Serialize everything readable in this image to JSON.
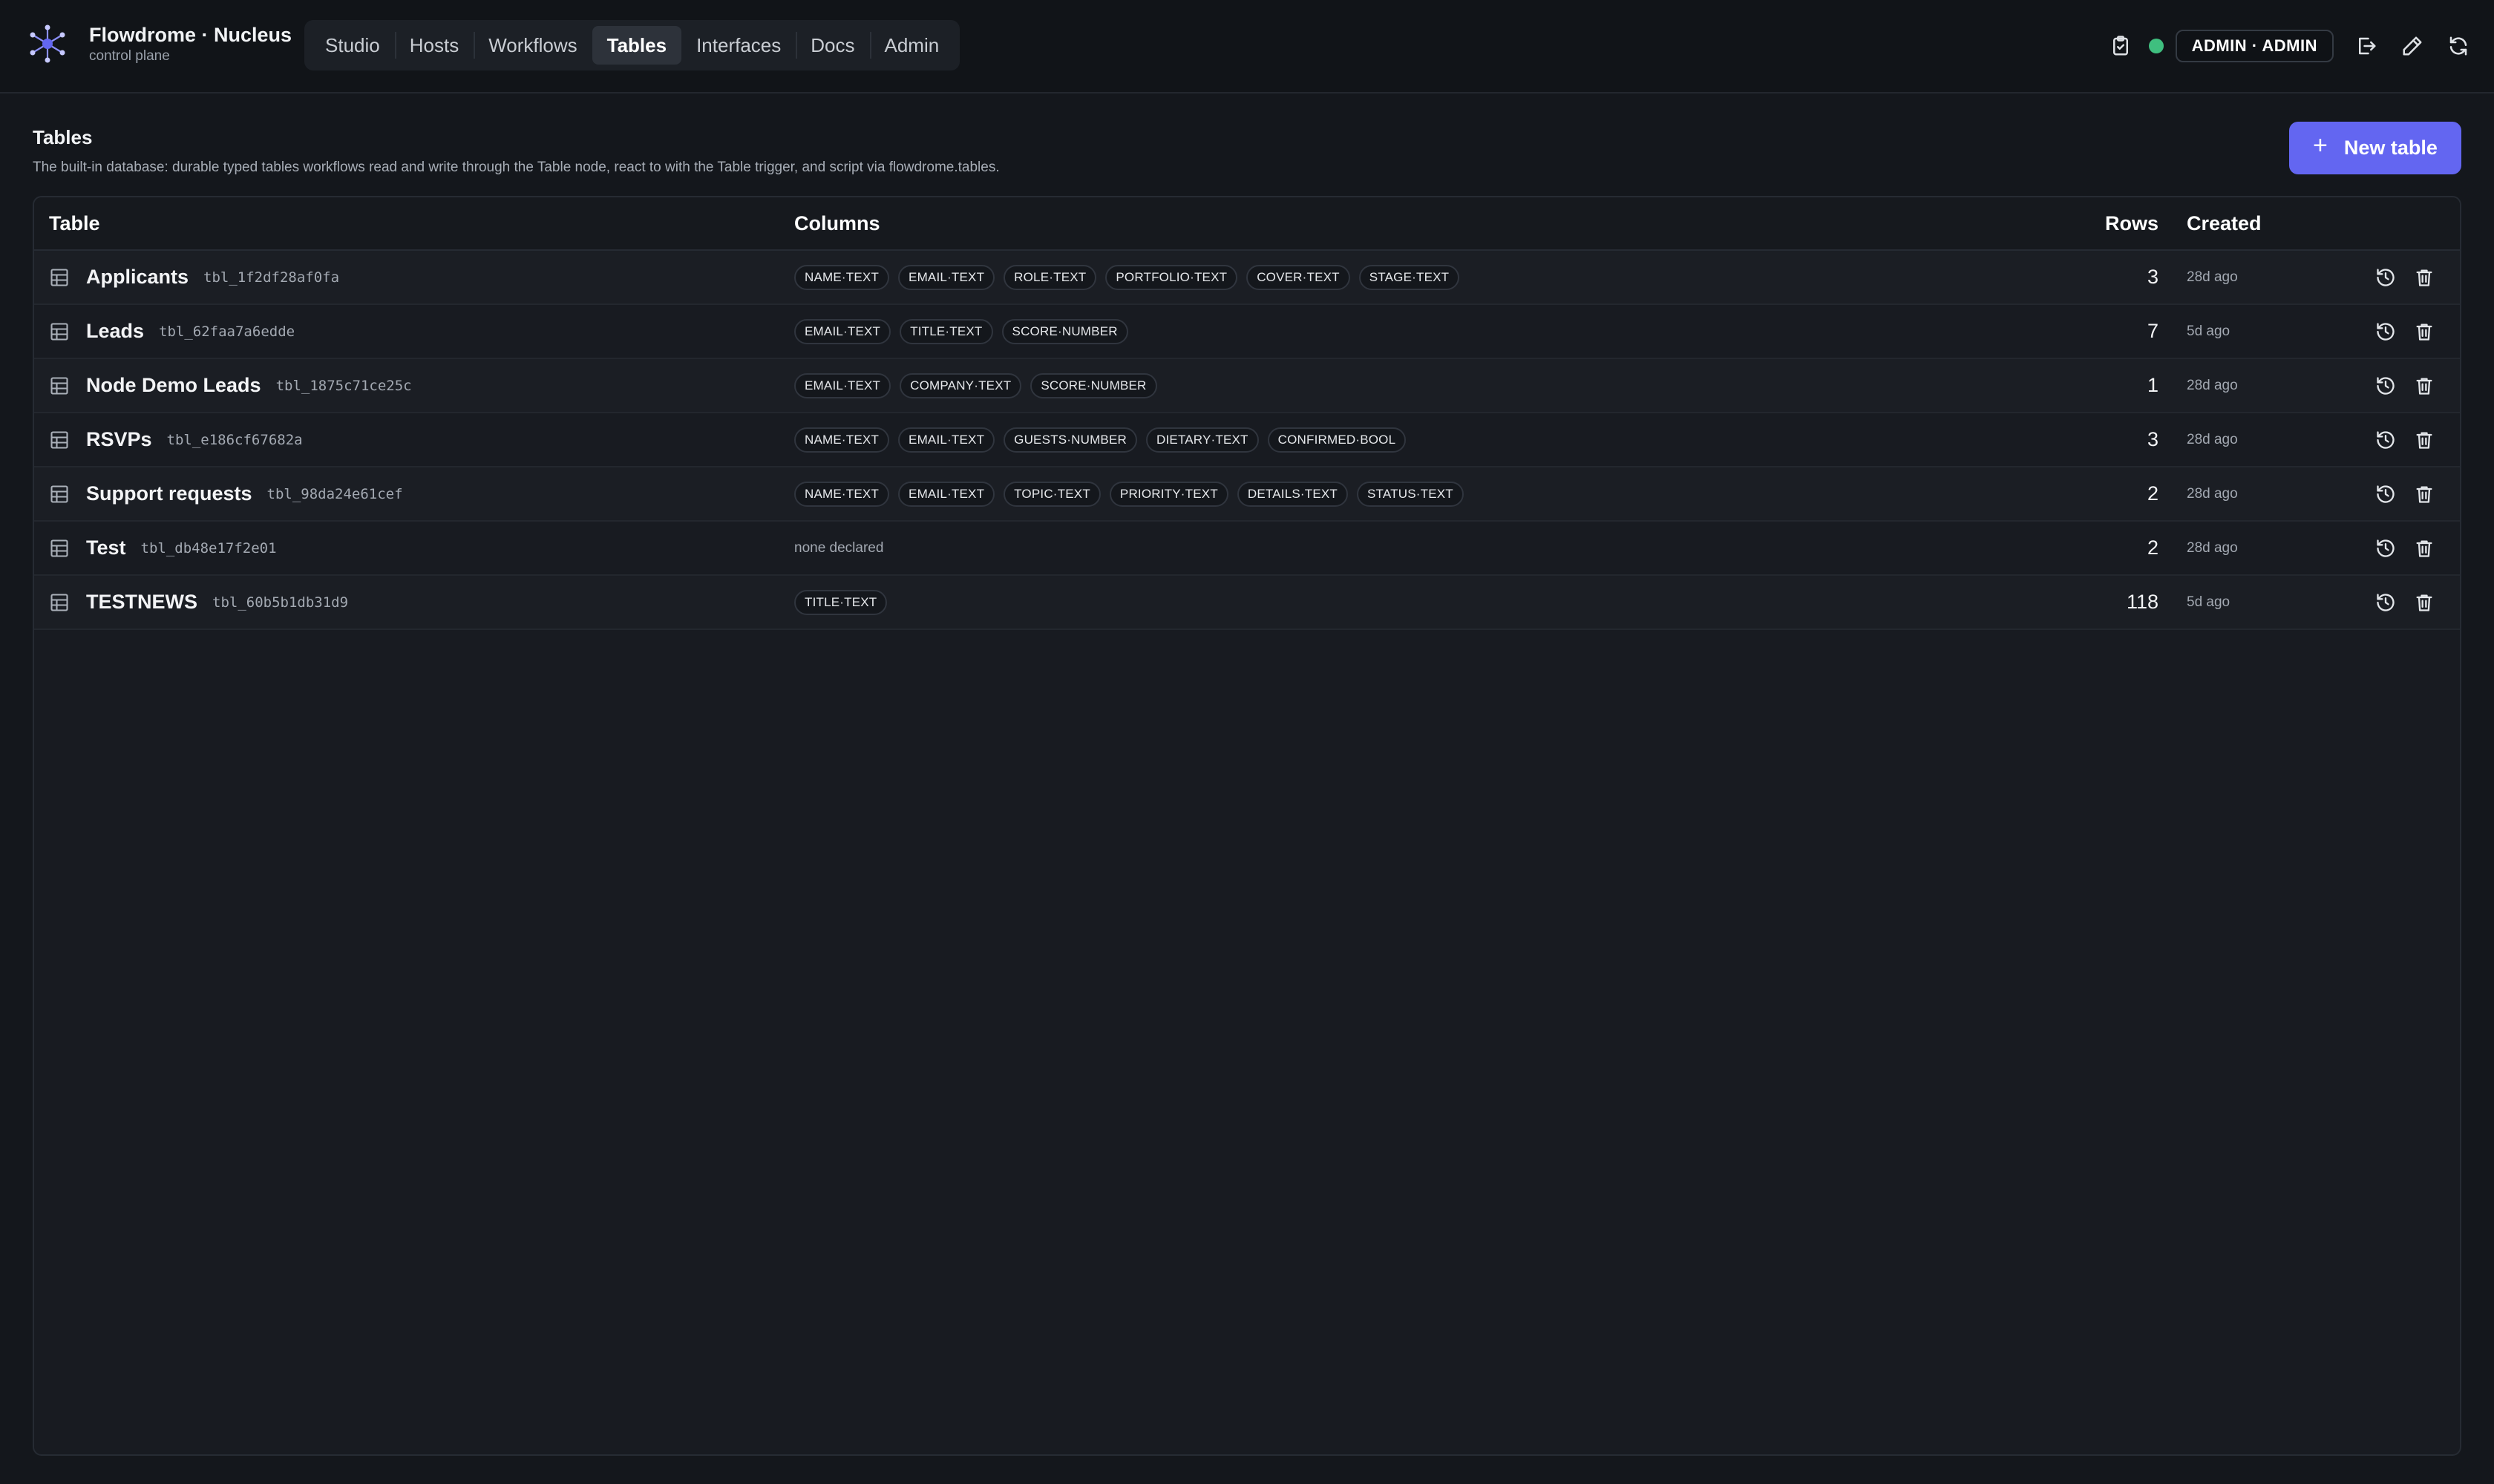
{
  "brand": {
    "title": "Flowdrome · Nucleus",
    "subtitle": "control plane"
  },
  "nav": {
    "items": [
      {
        "label": "Studio",
        "active": false
      },
      {
        "label": "Hosts",
        "active": false
      },
      {
        "label": "Workflows",
        "active": false
      },
      {
        "label": "Tables",
        "active": true
      },
      {
        "label": "Interfaces",
        "active": false
      },
      {
        "label": "Docs",
        "active": false
      },
      {
        "label": "Admin",
        "active": false
      }
    ]
  },
  "header_right": {
    "user_label": "ADMIN · ADMIN",
    "status_color": "#3fbf7f",
    "icons": [
      "clipboard-check-icon",
      "logout-icon",
      "edit-icon",
      "refresh-icon"
    ]
  },
  "page": {
    "title": "Tables",
    "description": "The built-in database: durable typed tables workflows read and write through the Table node, react to with the Table trigger, and script via flowdrome.tables.",
    "new_button_label": "New table",
    "accent_color": "#6366f1"
  },
  "table": {
    "headers": {
      "table": "Table",
      "columns": "Columns",
      "rows": "Rows",
      "created": "Created"
    },
    "rows": [
      {
        "name": "Applicants",
        "id": "tbl_1f2df28af0fa",
        "columns": [
          "NAME·TEXT",
          "EMAIL·TEXT",
          "ROLE·TEXT",
          "PORTFOLIO·TEXT",
          "COVER·TEXT",
          "STAGE·TEXT"
        ],
        "rows": "3",
        "created": "28d ago"
      },
      {
        "name": "Leads",
        "id": "tbl_62faa7a6edde",
        "columns": [
          "EMAIL·TEXT",
          "TITLE·TEXT",
          "SCORE·NUMBER"
        ],
        "rows": "7",
        "created": "5d ago"
      },
      {
        "name": "Node Demo Leads",
        "id": "tbl_1875c71ce25c",
        "columns": [
          "EMAIL·TEXT",
          "COMPANY·TEXT",
          "SCORE·NUMBER"
        ],
        "rows": "1",
        "created": "28d ago"
      },
      {
        "name": "RSVPs",
        "id": "tbl_e186cf67682a",
        "columns": [
          "NAME·TEXT",
          "EMAIL·TEXT",
          "GUESTS·NUMBER",
          "DIETARY·TEXT",
          "CONFIRMED·BOOL"
        ],
        "rows": "3",
        "created": "28d ago"
      },
      {
        "name": "Support requests",
        "id": "tbl_98da24e61cef",
        "columns": [
          "NAME·TEXT",
          "EMAIL·TEXT",
          "TOPIC·TEXT",
          "PRIORITY·TEXT",
          "DETAILS·TEXT",
          "STATUS·TEXT"
        ],
        "rows": "2",
        "created": "28d ago"
      },
      {
        "name": "Test",
        "id": "tbl_db48e17f2e01",
        "columns": [],
        "none_label": "none declared",
        "rows": "2",
        "created": "28d ago"
      },
      {
        "name": "TESTNEWS",
        "id": "tbl_60b5b1db31d9",
        "columns": [
          "TITLE·TEXT"
        ],
        "rows": "118",
        "created": "5d ago"
      }
    ]
  }
}
